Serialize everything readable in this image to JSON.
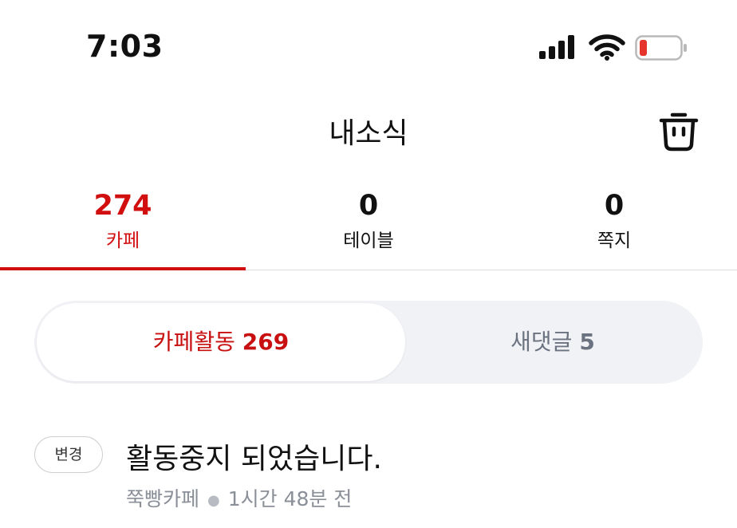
{
  "status_bar": {
    "time": "7:03",
    "battery_level": 0.15,
    "battery_color": "#e5342b"
  },
  "header": {
    "title": "내소식"
  },
  "tabs": [
    {
      "count": "274",
      "label": "카페",
      "active": true
    },
    {
      "count": "0",
      "label": "테이블",
      "active": false
    },
    {
      "count": "0",
      "label": "쪽지",
      "active": false
    }
  ],
  "segment": [
    {
      "label": "카페활동",
      "count": "269",
      "active": true
    },
    {
      "label": "새댓글",
      "count": "5",
      "active": false
    }
  ],
  "items": [
    {
      "badge": "변경",
      "title": "활동중지 되었습니다.",
      "source": "쭉빵카페",
      "time_ago": "1시간 48분 전"
    }
  ],
  "colors": {
    "accent": "#d10f0f",
    "inactive_text": "#6b7280",
    "segment_bg": "#f1f2f5"
  }
}
